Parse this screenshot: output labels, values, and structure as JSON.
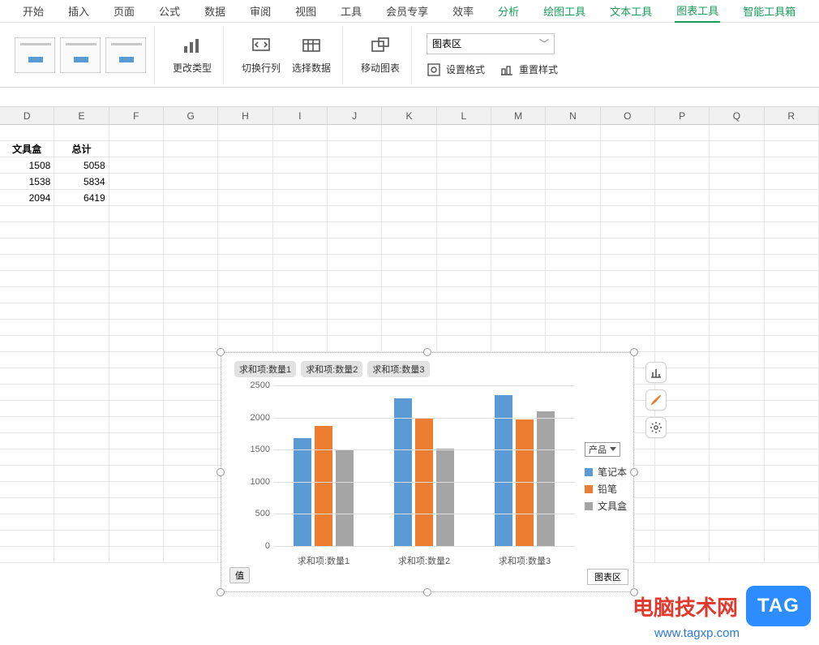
{
  "menu": {
    "items": [
      "开始",
      "插入",
      "页面",
      "公式",
      "数据",
      "审阅",
      "视图",
      "工具",
      "会员专享",
      "效率",
      "分析",
      "绘图工具",
      "文本工具",
      "图表工具",
      "智能工具箱"
    ],
    "green_from_index": 10,
    "active_index": 13
  },
  "ribbon": {
    "change_type": "更改类型",
    "switch_rc": "切换行列",
    "select_data": "选择数据",
    "move_chart": "移动图表",
    "chart_area": "图表区",
    "set_format": "设置格式",
    "reset_style": "重置样式"
  },
  "sheet": {
    "columns": [
      "D",
      "E",
      "F",
      "G",
      "H",
      "I",
      "J",
      "K",
      "L",
      "M",
      "N",
      "O",
      "P",
      "Q",
      "R"
    ],
    "headers": {
      "c1": "文具盒",
      "c2": "总计"
    },
    "rows": [
      {
        "c1": "1508",
        "c2": "5058"
      },
      {
        "c1": "1538",
        "c2": "5834"
      },
      {
        "c1": "2094",
        "c2": "6419"
      }
    ]
  },
  "chart_data": {
    "type": "bar",
    "categories": [
      "求和项:数量1",
      "求和项:数量2",
      "求和项:数量3"
    ],
    "series": [
      {
        "name": "笔记本",
        "values": [
          1680,
          2300,
          2350
        ]
      },
      {
        "name": "铅笔",
        "values": [
          1870,
          1990,
          1970
        ]
      },
      {
        "name": "文具盒",
        "values": [
          1500,
          1520,
          2090
        ]
      }
    ],
    "ylim": [
      0,
      2500
    ],
    "ystep": 500,
    "yticks": [
      2500,
      2000,
      1500,
      1000,
      500,
      0
    ],
    "top_chips": [
      "求和项:数量1",
      "求和项:数量2",
      "求和项:数量3"
    ],
    "legend_title": "产品",
    "value_button": "值",
    "tooltip": "图表区"
  },
  "watermark": {
    "text": "电脑技术网",
    "url": "www.tagxp.com",
    "badge": "TAG"
  }
}
